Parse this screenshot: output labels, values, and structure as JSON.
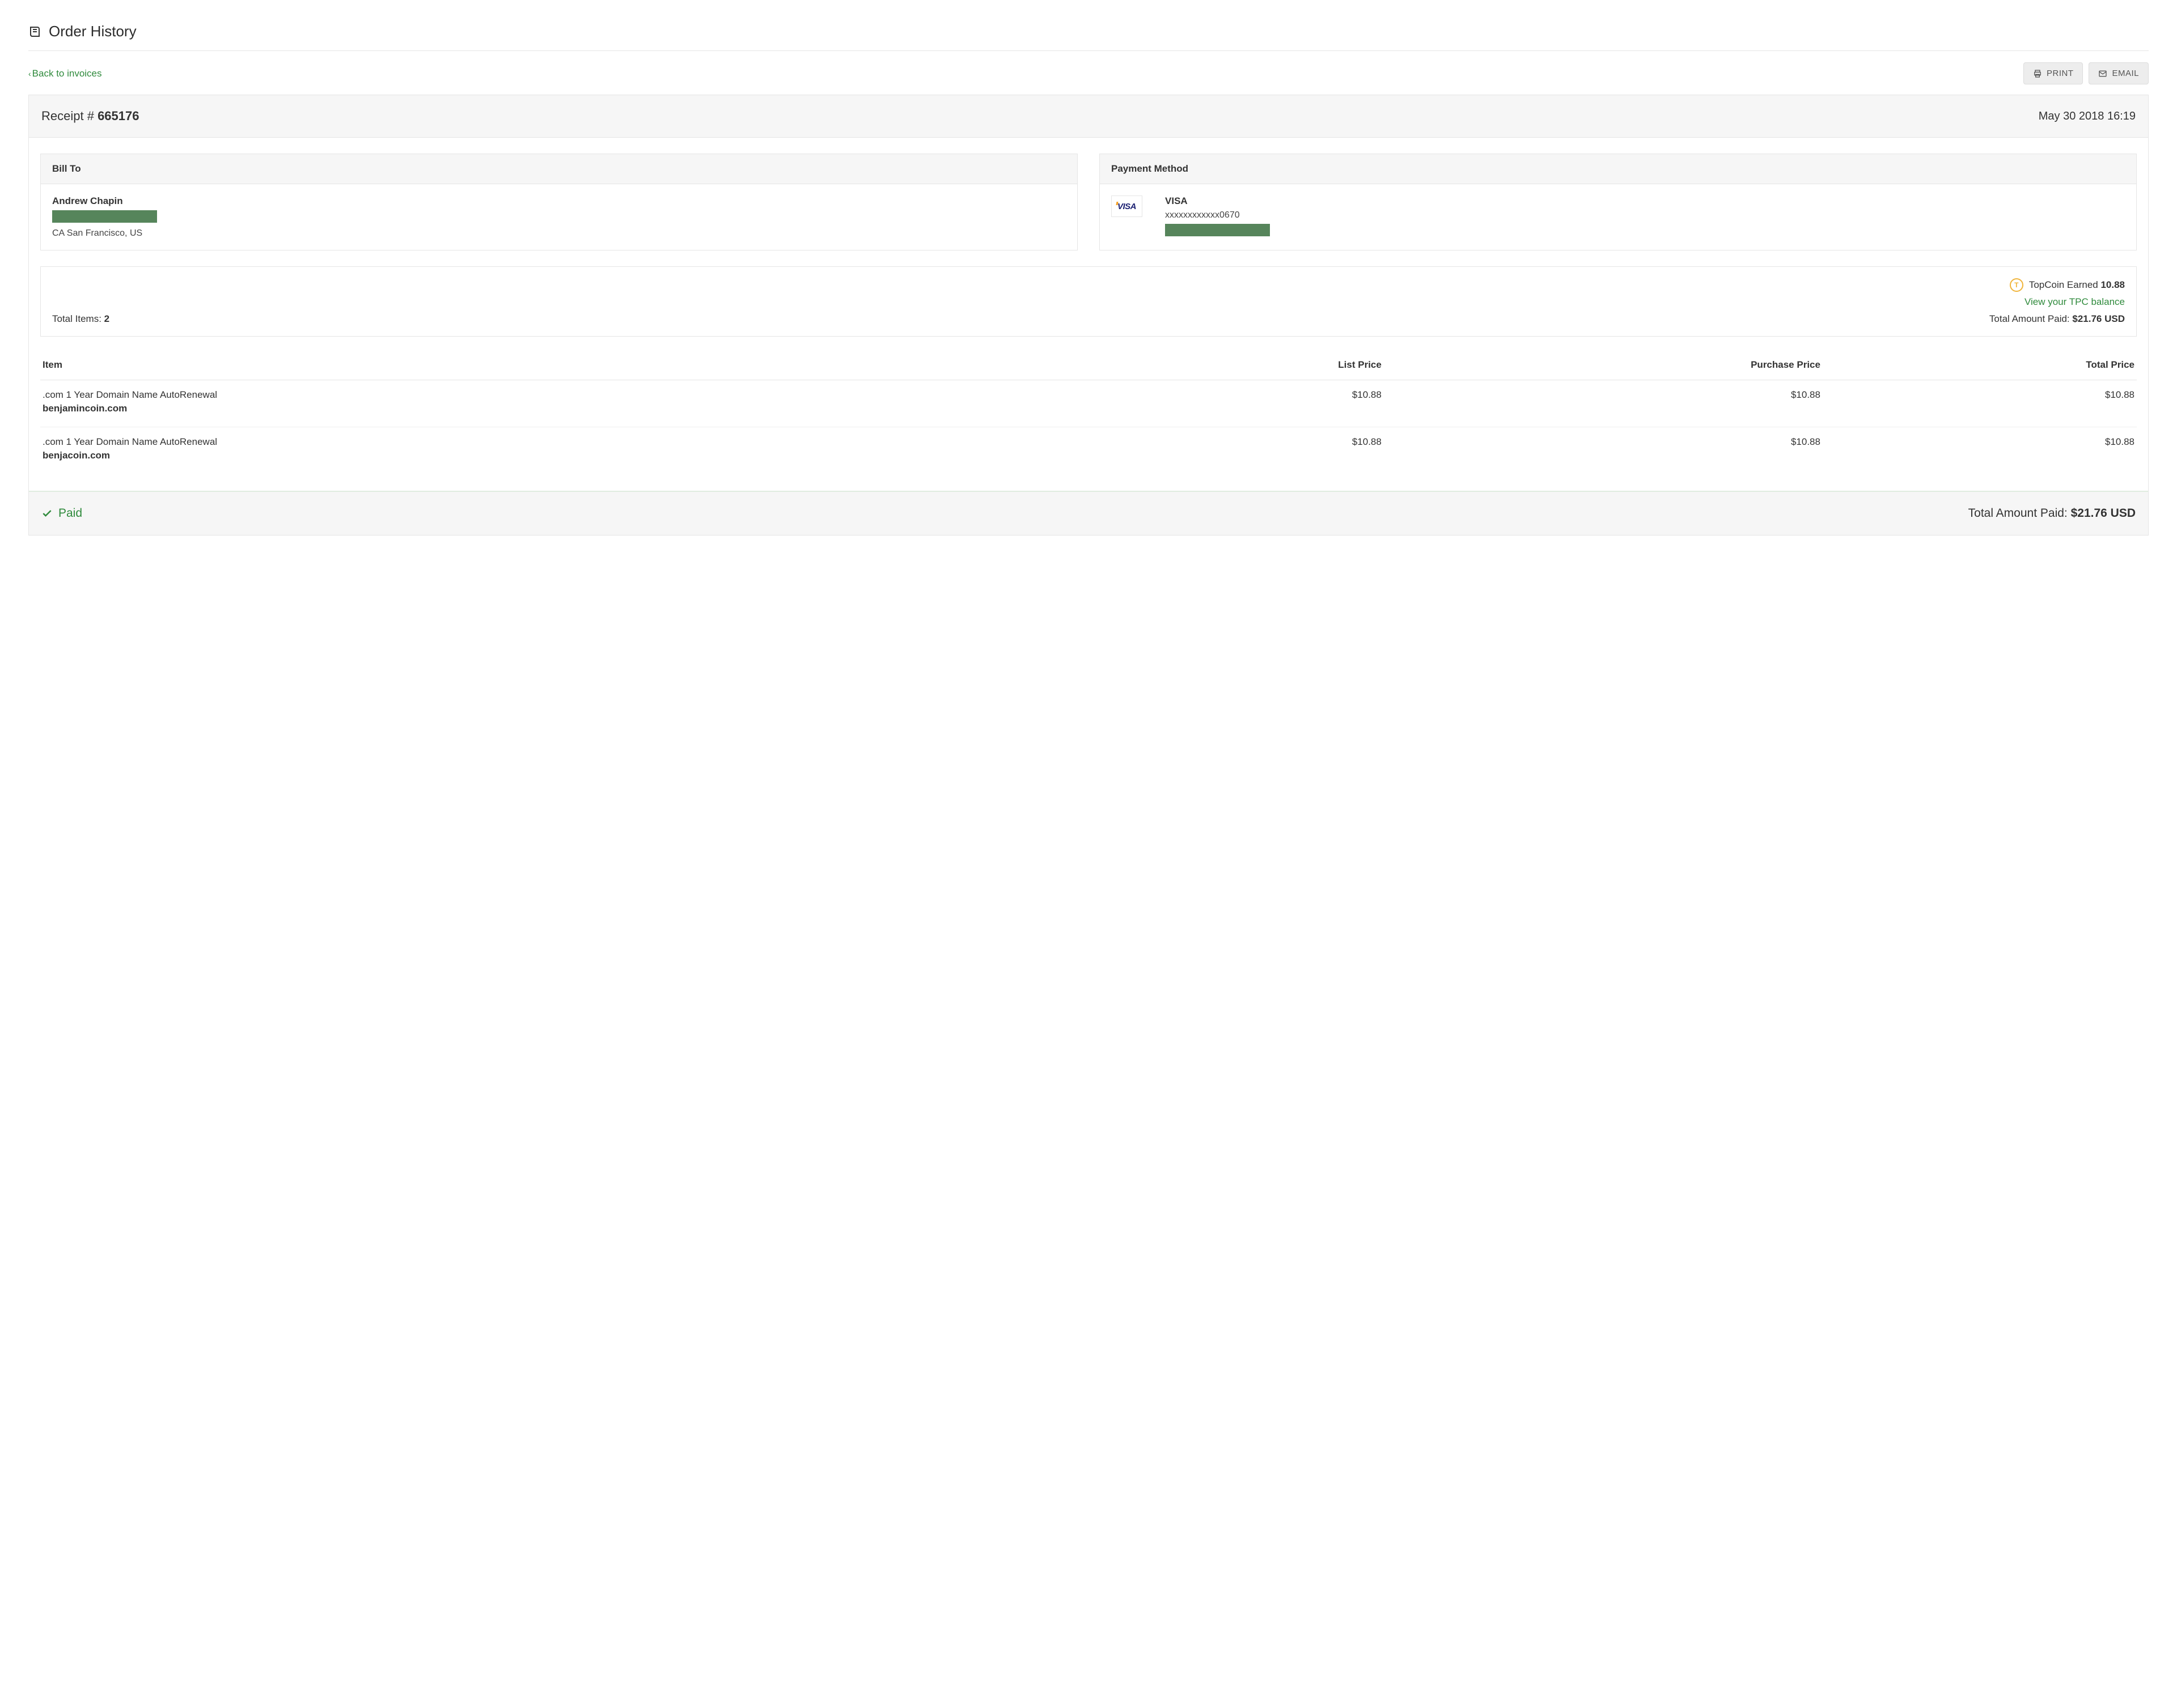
{
  "page": {
    "title": "Order History",
    "back_link": "Back to invoices",
    "print_label": "PRINT",
    "email_label": "EMAIL"
  },
  "receipt": {
    "label": "Receipt # ",
    "number": "665176",
    "date": "May 30 2018 16:19"
  },
  "billto": {
    "header": "Bill To",
    "name": "Andrew Chapin",
    "location": "CA San Francisco, US"
  },
  "payment": {
    "header": "Payment Method",
    "type": "VISA",
    "mask": "xxxxxxxxxxxx0670"
  },
  "topcoin": {
    "label": "TopCoin Earned ",
    "amount": "10.88",
    "view_link": "View your TPC balance"
  },
  "summary": {
    "total_items_label": "Total Items: ",
    "total_items": "2",
    "total_paid_label": "Total Amount Paid: ",
    "total_paid": "$21.76 USD"
  },
  "columns": {
    "item": "Item",
    "list": "List Price",
    "purchase": "Purchase Price",
    "total": "Total Price"
  },
  "items": [
    {
      "desc": ".com 1 Year Domain Name AutoRenewal",
      "domain": "benjamincoin.com",
      "list": "$10.88",
      "purchase": "$10.88",
      "total": "$10.88"
    },
    {
      "desc": ".com 1 Year Domain Name AutoRenewal",
      "domain": "benjacoin.com",
      "list": "$10.88",
      "purchase": "$10.88",
      "total": "$10.88"
    }
  ],
  "footer": {
    "paid": "Paid",
    "total_label": "Total Amount Paid: ",
    "total": "$21.76 USD"
  }
}
